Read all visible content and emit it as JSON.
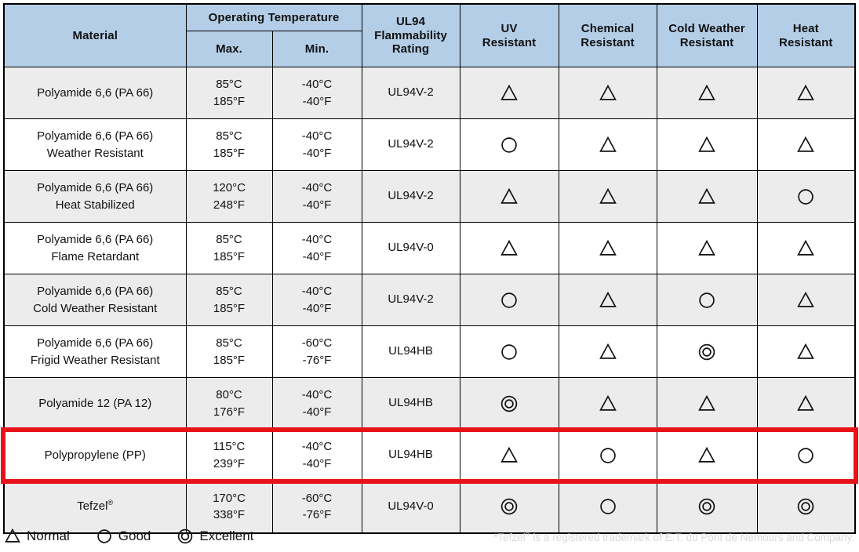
{
  "table": {
    "headers": {
      "material": "Material",
      "operating_temperature": "Operating Temperature",
      "max": "Max.",
      "min": "Min.",
      "ul94": "UL94\nFlammability\nRating",
      "ul94_line1": "UL94",
      "ul94_line2": "Flammability",
      "ul94_line3": "Rating",
      "uv_line1": "UV",
      "uv_line2": "Resistant",
      "chemical_line1": "Chemical",
      "chemical_line2": "Resistant",
      "cold_line1": "Cold Weather",
      "cold_line2": "Resistant",
      "heat_line1": "Heat",
      "heat_line2": "Resistant"
    },
    "rows": [
      {
        "material_line1": "Polyamide 6,6 (PA 66)",
        "material_line2": "",
        "max_c": "85°C",
        "max_f": "185°F",
        "min_c": "-40°C",
        "min_f": "-40°F",
        "ul94": "UL94V-2",
        "uv": "normal",
        "chemical": "normal",
        "cold": "normal",
        "heat": "normal",
        "shaded": true,
        "highlighted": false
      },
      {
        "material_line1": "Polyamide 6,6 (PA 66)",
        "material_line2": "Weather Resistant",
        "max_c": "85°C",
        "max_f": "185°F",
        "min_c": "-40°C",
        "min_f": "-40°F",
        "ul94": "UL94V-2",
        "uv": "good",
        "chemical": "normal",
        "cold": "normal",
        "heat": "normal",
        "shaded": false,
        "highlighted": false
      },
      {
        "material_line1": "Polyamide 6,6 (PA 66)",
        "material_line2": "Heat Stabilized",
        "max_c": "120°C",
        "max_f": "248°F",
        "min_c": "-40°C",
        "min_f": "-40°F",
        "ul94": "UL94V-2",
        "uv": "normal",
        "chemical": "normal",
        "cold": "normal",
        "heat": "good",
        "shaded": true,
        "highlighted": false
      },
      {
        "material_line1": "Polyamide 6,6 (PA 66)",
        "material_line2": "Flame Retardant",
        "max_c": "85°C",
        "max_f": "185°F",
        "min_c": "-40°C",
        "min_f": "-40°F",
        "ul94": "UL94V-0",
        "uv": "normal",
        "chemical": "normal",
        "cold": "normal",
        "heat": "normal",
        "shaded": false,
        "highlighted": false
      },
      {
        "material_line1": "Polyamide 6,6 (PA 66)",
        "material_line2": "Cold Weather Resistant",
        "max_c": "85°C",
        "max_f": "185°F",
        "min_c": "-40°C",
        "min_f": "-40°F",
        "ul94": "UL94V-2",
        "uv": "good",
        "chemical": "normal",
        "cold": "good",
        "heat": "normal",
        "shaded": true,
        "highlighted": false
      },
      {
        "material_line1": "Polyamide 6,6 (PA 66)",
        "material_line2": "Frigid Weather Resistant",
        "max_c": "85°C",
        "max_f": "185°F",
        "min_c": "-60°C",
        "min_f": "-76°F",
        "ul94": "UL94HB",
        "uv": "good",
        "chemical": "normal",
        "cold": "excellent",
        "heat": "normal",
        "shaded": false,
        "highlighted": false
      },
      {
        "material_line1": "Polyamide 12 (PA 12)",
        "material_line2": "",
        "max_c": "80°C",
        "max_f": "176°F",
        "min_c": "-40°C",
        "min_f": "-40°F",
        "ul94": "UL94HB",
        "uv": "excellent",
        "chemical": "normal",
        "cold": "normal",
        "heat": "normal",
        "shaded": true,
        "highlighted": false
      },
      {
        "material_line1": "Polypropylene (PP)",
        "material_line2": "",
        "max_c": "115°C",
        "max_f": "239°F",
        "min_c": "-40°C",
        "min_f": "-40°F",
        "ul94": "UL94HB",
        "uv": "normal",
        "chemical": "good",
        "cold": "normal",
        "heat": "good",
        "shaded": false,
        "highlighted": true
      },
      {
        "material_line1": "Tefzel®",
        "material_line2": "",
        "max_c": "170°C",
        "max_f": "338°F",
        "min_c": "-60°C",
        "min_f": "-76°F",
        "ul94": "UL94V-0",
        "uv": "excellent",
        "chemical": "good",
        "cold": "excellent",
        "heat": "excellent",
        "shaded": true,
        "highlighted": false
      }
    ]
  },
  "legend": {
    "items": [
      {
        "symbol": "normal",
        "label": "Normal"
      },
      {
        "symbol": "good",
        "label": "Good"
      },
      {
        "symbol": "excellent",
        "label": "Excellent"
      }
    ]
  },
  "footnote": {
    "text": "*Tefzel® is a registered trademark of E.T. du Pont de Nemours and Company."
  },
  "colors": {
    "header_blue": "#b4cee8",
    "row_shade": "#ececec",
    "row_plain": "#ffffff",
    "highlight_red": "#e8131a",
    "border": "#000000",
    "footnote_gray": "#d9d9d9"
  }
}
